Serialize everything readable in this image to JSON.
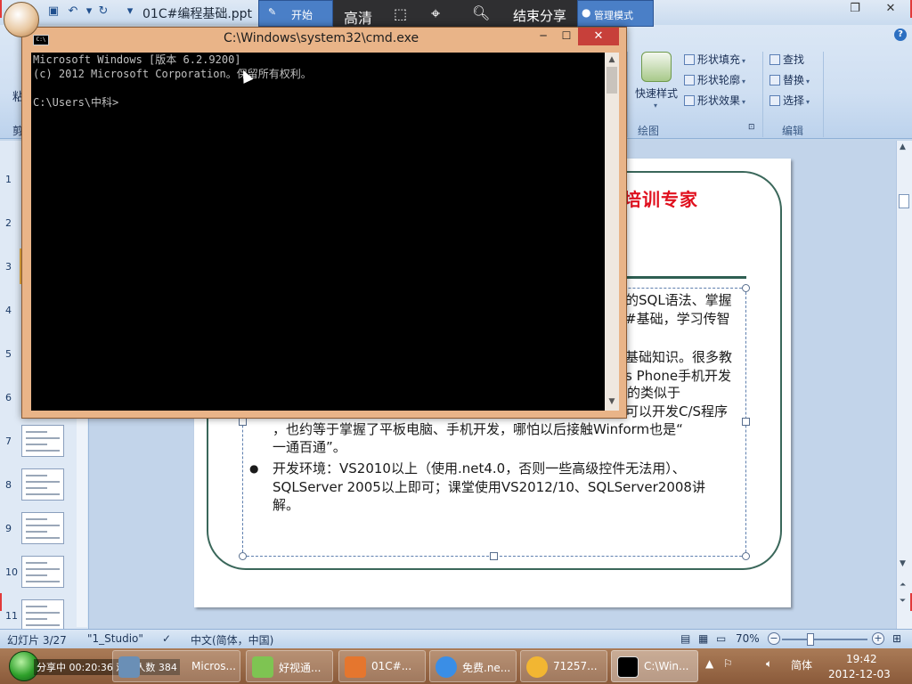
{
  "ppt": {
    "filename": "01C#编程基础.ppt",
    "ribbon": {
      "paste_label": "粘",
      "clipboard_label": "剪",
      "quick_style": "快速样式",
      "shape_fill": "形状填充",
      "shape_outline": "形状轮廓",
      "shape_effect": "形状效果",
      "find": "查找",
      "replace": "替换",
      "select": "选择",
      "group_drawing": "绘图",
      "group_edit": "编辑"
    },
    "thumbnails": [
      "1",
      "2",
      "3",
      "4",
      "5",
      "6",
      "7",
      "8",
      "9",
      "10",
      "11"
    ],
    "slide": {
      "heading": "培训专家",
      "text_lines": [
        "的SQL语法、掌握",
        "#基础，学习传智",
        "基础知识。很多教",
        "s Phone手机开发",
        "的类似于",
        "可以开发C/S程序",
        "，也约等于掌握了平板电脑、手机开发，哪怕以后接触Winform也是“",
        "一通百通”。",
        "开发环境：VS2010以上（使用.net4.0，否则一些高级控件无法用）、",
        "SQLServer 2005以上即可；课堂使用VS2012/10、SQLServer2008讲",
        "解。"
      ],
      "bullet": "●"
    },
    "status": {
      "slide_count": "幻灯片 3/27",
      "theme": "\"1_Studio\"",
      "language": "中文(简体，中国)",
      "zoom": "70%"
    }
  },
  "share_toolbar": {
    "start": "开始",
    "hd": "高清",
    "end_share": "结束分享",
    "admin_mode": "管理模式"
  },
  "cmd": {
    "title": "C:\\Windows\\system32\\cmd.exe",
    "lines": [
      "Microsoft Windows [版本 6.2.9200]",
      "(c) 2012 Microsoft Corporation。保留所有权利。",
      "",
      "C:\\Users\\中科>"
    ]
  },
  "taskbar": {
    "share_status": "分享中  00:20:36  观看人数 384",
    "apps": [
      {
        "label": "Micros..."
      },
      {
        "label": "好视通..."
      },
      {
        "label": "01C#..."
      },
      {
        "label": "免费.ne..."
      },
      {
        "label": "71257..."
      },
      {
        "label": "C:\\Win..."
      }
    ],
    "ime": "简体",
    "time": "19:42",
    "date": "2012-12-03"
  },
  "colors": {
    "heading_red": "#e0101e",
    "frame_green": "#3a675a",
    "taskbar_brown": "#8a5a3a",
    "cmd_frame": "#e9b488"
  }
}
